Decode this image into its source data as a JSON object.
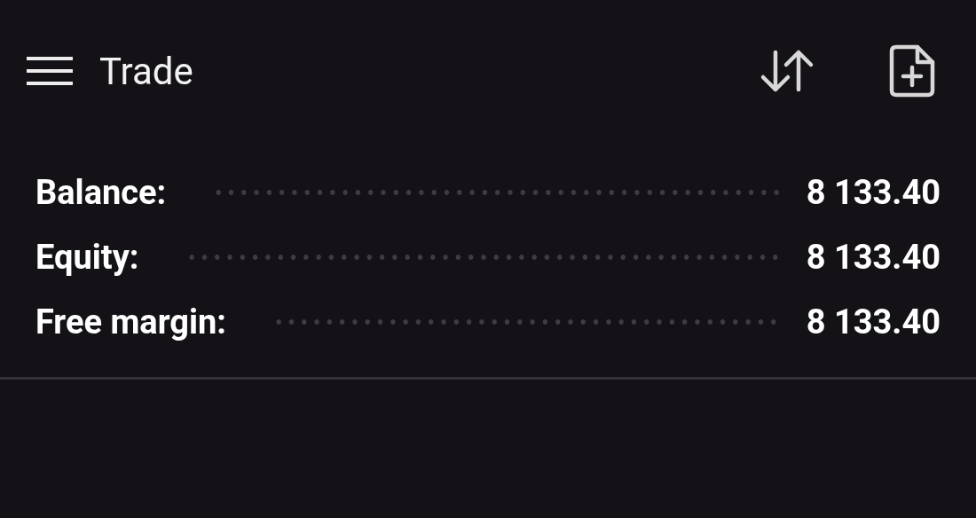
{
  "header": {
    "title": "Trade"
  },
  "account": [
    {
      "label": "Balance:",
      "value": "8 133.40"
    },
    {
      "label": "Equity:",
      "value": "8 133.40"
    },
    {
      "label": "Free margin:",
      "value": "8 133.40"
    }
  ]
}
